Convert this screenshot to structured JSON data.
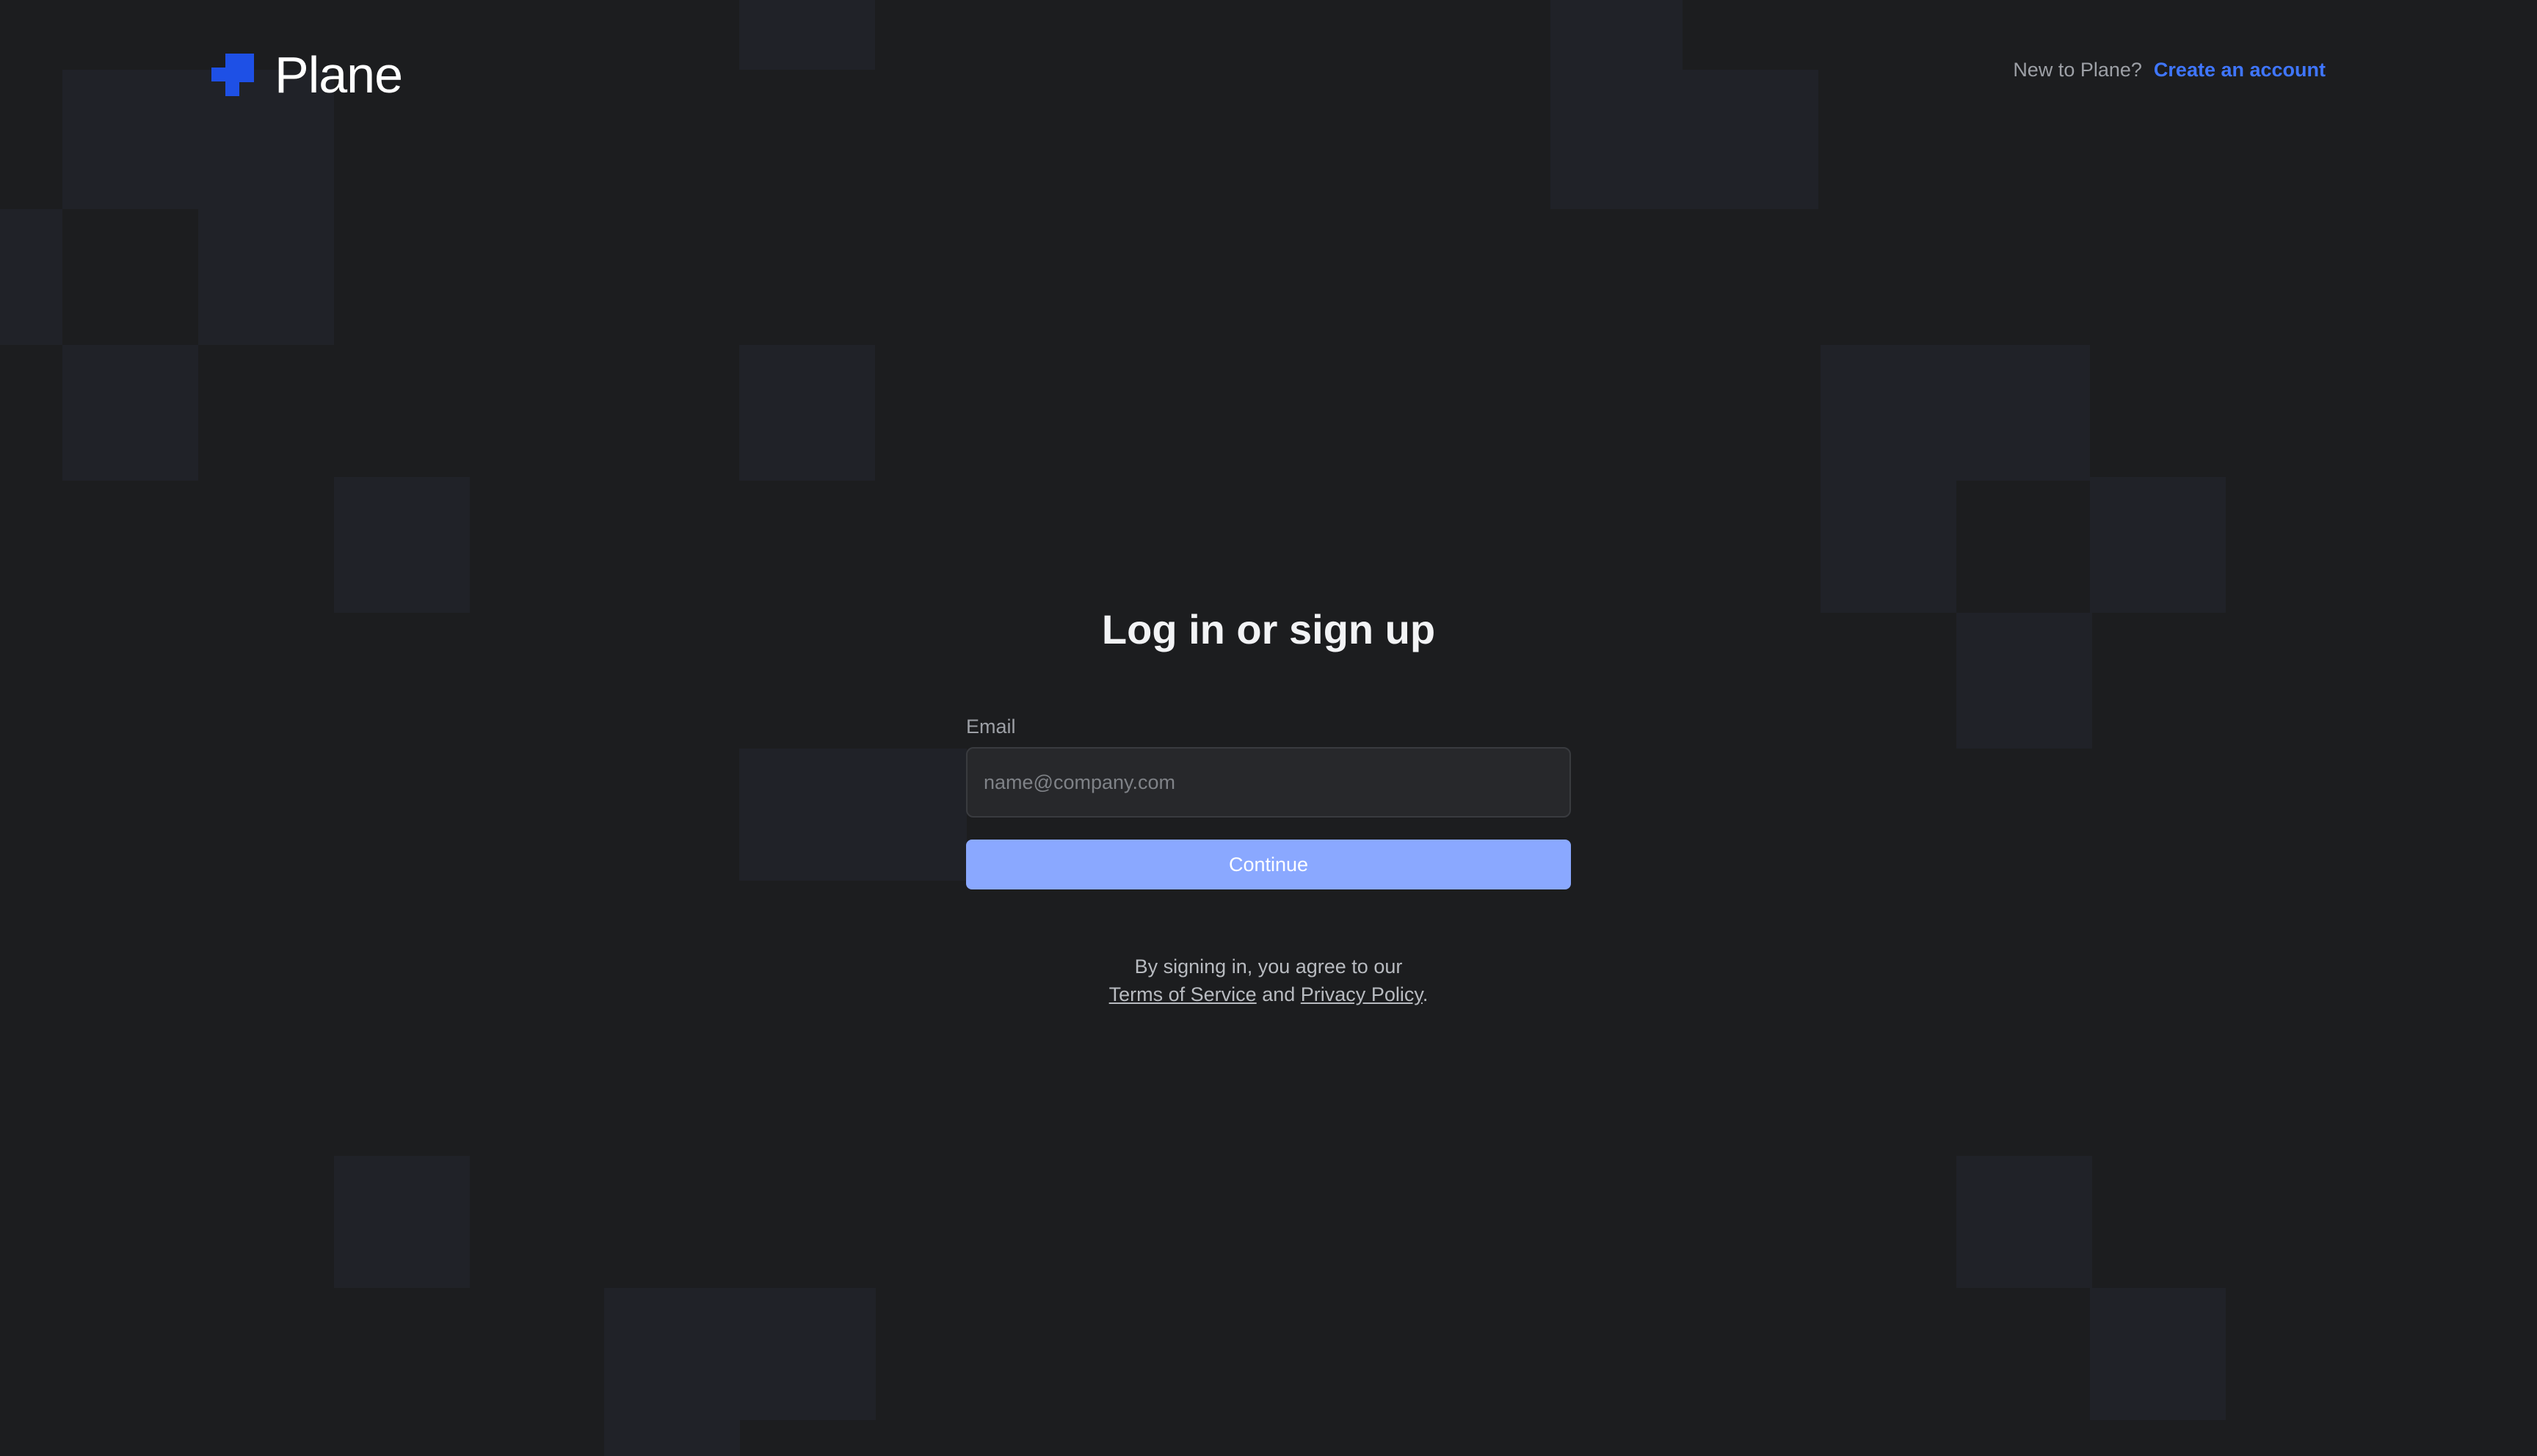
{
  "brand": {
    "name": "Plane",
    "accent_color": "#3f76ff",
    "logo_color": "#1e50e6"
  },
  "header": {
    "prompt": "New to Plane?",
    "signup_link": "Create an account"
  },
  "auth": {
    "title": "Log in or sign up",
    "email_label": "Email",
    "email_placeholder": "name@company.com",
    "email_value": "",
    "continue_label": "Continue"
  },
  "legal": {
    "prefix": "By signing in, you agree to our",
    "terms_label": "Terms of Service",
    "and_text": "and",
    "privacy_label": "Privacy Policy",
    "suffix": "."
  },
  "colors": {
    "background": "#1c1d1f",
    "grid_tile": "#202228",
    "button": "#8aa8ff"
  }
}
